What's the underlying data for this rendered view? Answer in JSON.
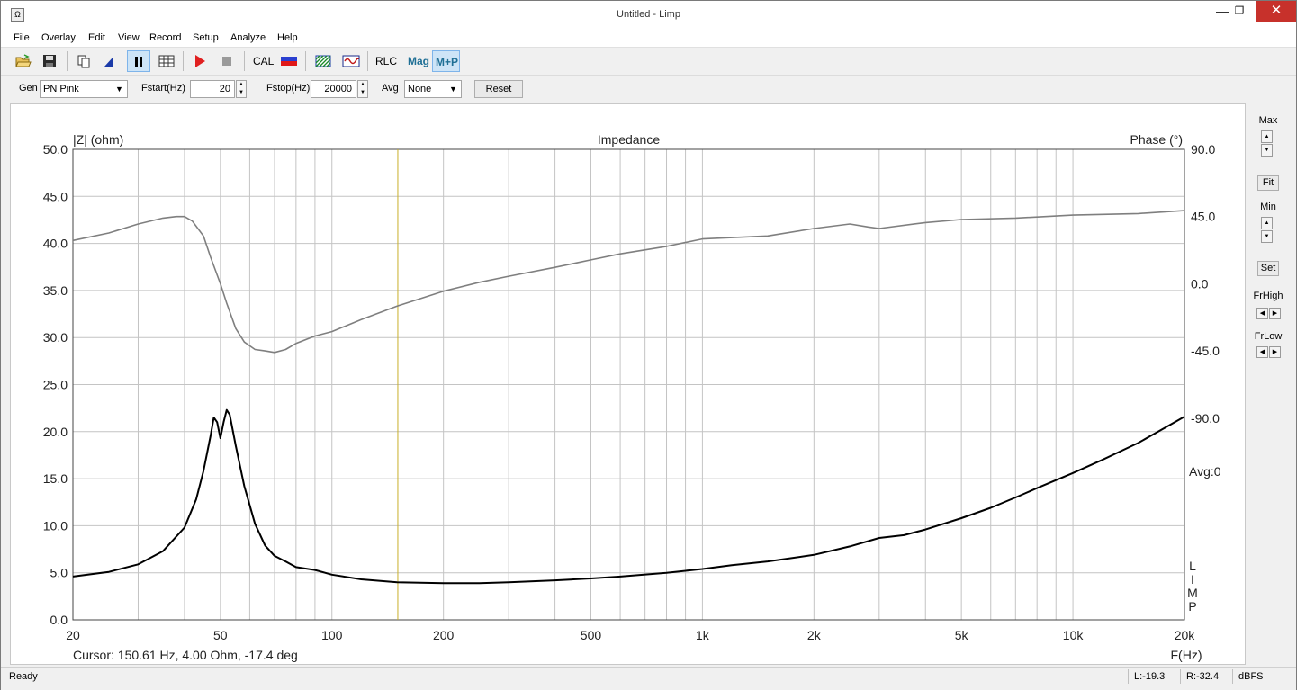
{
  "window": {
    "title": "Untitled - Limp",
    "icon_glyph": "Ω",
    "minimize": "—",
    "maximize": "❐",
    "close": "✕"
  },
  "menu": [
    "File",
    "Overlay",
    "Edit",
    "View",
    "Record",
    "Setup",
    "Analyze",
    "Help"
  ],
  "toolbar": {
    "cal": "CAL",
    "rlc": "RLC",
    "mag": "Mag",
    "mp": "M+P",
    "icons": [
      "open-folder-icon",
      "save-icon",
      "copy-icon",
      "marker-icon",
      "pause-icon",
      "table-icon",
      "play-icon",
      "stop-icon",
      "cal-icon",
      "color-bar-icon",
      "hatch-icon",
      "sine-wave-icon"
    ]
  },
  "params": {
    "gen_label": "Gen",
    "gen_value": "PN Pink",
    "fstart_label": "Fstart(Hz)",
    "fstart_value": "20",
    "fstop_label": "Fstop(Hz)",
    "fstop_value": "20000",
    "avg_label": "Avg",
    "avg_value": "None",
    "reset": "Reset"
  },
  "right_panel": {
    "max": "Max",
    "fit": "Fit",
    "min": "Min",
    "set": "Set",
    "frhigh": "FrHigh",
    "frlow": "FrLow"
  },
  "chart_data": {
    "type": "line",
    "title": "Impedance",
    "ylabel_left": "|Z| (ohm)",
    "ylabel_right": "Phase (°)",
    "xlabel": "F(Hz)",
    "x_scale": "log",
    "xlim": [
      20,
      20000
    ],
    "ylim_left": [
      0,
      50
    ],
    "ylim_right": [
      -225,
      90
    ],
    "x_ticks": [
      20,
      50,
      100,
      200,
      500,
      1000,
      2000,
      5000,
      10000,
      20000
    ],
    "x_tick_labels": [
      "20",
      "50",
      "100",
      "200",
      "500",
      "1k",
      "2k",
      "5k",
      "10k",
      "20k"
    ],
    "y_left_ticks": [
      "0.0",
      "5.0",
      "10.0",
      "15.0",
      "20.0",
      "25.0",
      "30.0",
      "35.0",
      "40.0",
      "45.0",
      "50.0"
    ],
    "y_right_ticks": [
      "90.0",
      "45.0",
      "0.0",
      "-45.0",
      "-90.0"
    ],
    "grid": true,
    "avg_label": "Avg:0",
    "logo": [
      "L",
      "I",
      "M",
      "P"
    ],
    "cursor": {
      "freq": 150.61,
      "text": "Cursor: 150.61 Hz, 4.00 Ohm, -17.4 deg"
    },
    "series": [
      {
        "name": "|Z|",
        "axis": "left",
        "color": "#000000",
        "x": [
          20,
          25,
          30,
          35,
          40,
          43,
          45,
          47,
          48,
          49,
          50,
          51,
          52,
          53,
          55,
          58,
          62,
          66,
          70,
          75,
          80,
          90,
          100,
          120,
          150,
          200,
          250,
          300,
          400,
          500,
          600,
          800,
          1000,
          1200,
          1500,
          2000,
          2500,
          3000,
          3500,
          4000,
          5000,
          6000,
          7000,
          8000,
          10000,
          12000,
          15000,
          20000
        ],
        "y": [
          4.6,
          5.1,
          5.9,
          7.3,
          9.8,
          12.8,
          15.8,
          19.5,
          21.5,
          21.0,
          19.3,
          21.0,
          22.3,
          21.8,
          18.5,
          14.2,
          10.2,
          7.9,
          6.8,
          6.2,
          5.6,
          5.3,
          4.8,
          4.3,
          4.0,
          3.9,
          3.9,
          4.0,
          4.2,
          4.4,
          4.6,
          5.0,
          5.4,
          5.8,
          6.2,
          6.9,
          7.8,
          8.7,
          9.0,
          9.6,
          10.8,
          11.9,
          13.0,
          14.0,
          15.6,
          17.0,
          18.8,
          21.6
        ]
      },
      {
        "name": "Phase",
        "axis": "right",
        "color": "#7f7f7f",
        "x": [
          20,
          25,
          30,
          35,
          38,
          40,
          42,
          45,
          47,
          50,
          52,
          55,
          58,
          62,
          66,
          70,
          75,
          80,
          90,
          100,
          120,
          150,
          200,
          250,
          300,
          400,
          500,
          600,
          800,
          1000,
          1500,
          2000,
          2500,
          2800,
          3000,
          4000,
          5000,
          7000,
          10000,
          15000,
          20000
        ],
        "y": [
          29,
          34,
          40,
          44,
          45,
          45,
          42,
          32,
          18,
          0,
          -13,
          -30,
          -39,
          -44,
          -45,
          -46,
          -44,
          -40,
          -35,
          -32,
          -24,
          -15,
          -5,
          1,
          5,
          11,
          16,
          20,
          25,
          30,
          32,
          37,
          40,
          38,
          37,
          41,
          43,
          44,
          46,
          47,
          49
        ]
      }
    ]
  },
  "status": {
    "ready": "Ready",
    "left": "L:-19.3",
    "right": "R:-32.4",
    "unit": "dBFS"
  }
}
